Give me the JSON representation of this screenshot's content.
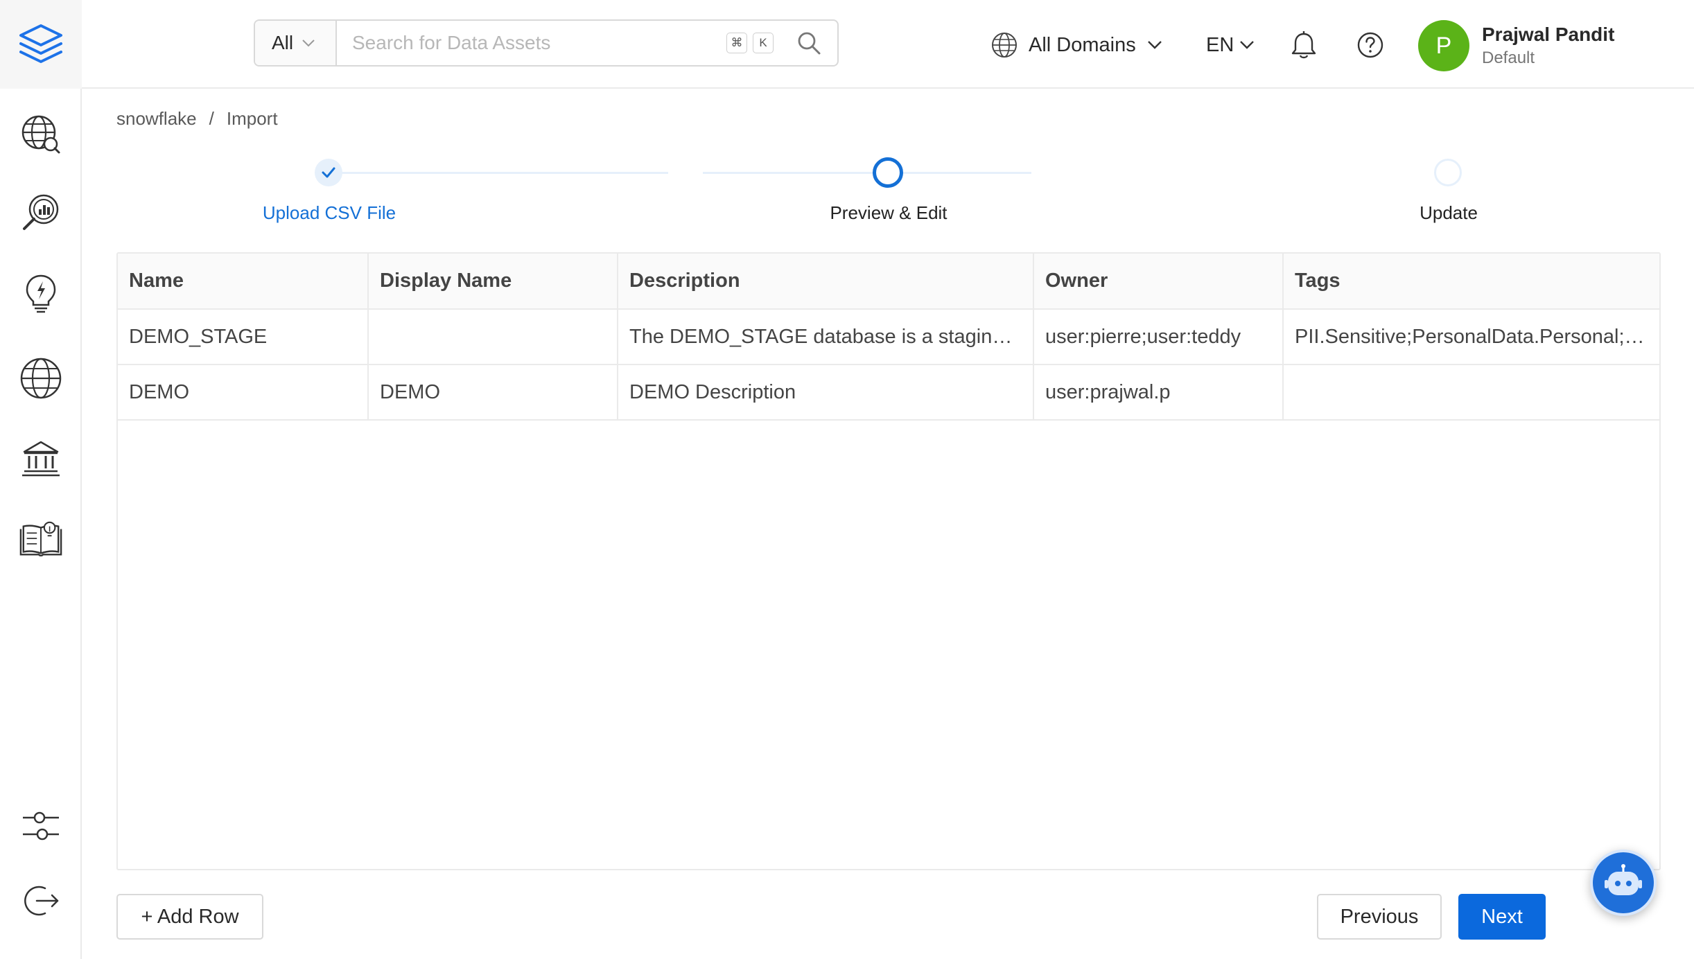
{
  "header": {
    "search": {
      "type_label": "All",
      "placeholder": "Search for Data Assets",
      "shortcut_key": "K"
    },
    "domain_label": "All Domains",
    "language": "EN",
    "user": {
      "initial": "P",
      "name": "Prajwal Pandit",
      "role": "Default"
    }
  },
  "breadcrumb": {
    "items": [
      "snowflake",
      "Import"
    ],
    "separator": "/"
  },
  "stepper": {
    "steps": [
      {
        "label": "Upload CSV File",
        "state": "completed"
      },
      {
        "label": "Preview & Edit",
        "state": "active"
      },
      {
        "label": "Update",
        "state": "pending"
      }
    ]
  },
  "table": {
    "columns": [
      "Name",
      "Display Name",
      "Description",
      "Owner",
      "Tags"
    ],
    "rows": [
      [
        "DEMO_STAGE",
        "",
        "The DEMO_STAGE database is a staging area for ingestion",
        "user:pierre;user:teddy",
        "PII.Sensitive;PersonalData.Personal;Retention.Archived"
      ],
      [
        "DEMO",
        "DEMO",
        "DEMO Description",
        "user:prajwal.p",
        ""
      ]
    ]
  },
  "footer": {
    "add_row_label": "+ Add Row",
    "previous_label": "Previous",
    "next_label": "Next"
  },
  "colors": {
    "primary": "#0b69dd",
    "avatar": "#5bb318",
    "step_link": "#1470d6"
  },
  "icons": {
    "sidebar": [
      "explore-icon",
      "data-insights-icon",
      "observability-icon",
      "domains-icon",
      "governance-icon",
      "knowledge-icon",
      "settings-icon",
      "logout-icon"
    ]
  }
}
